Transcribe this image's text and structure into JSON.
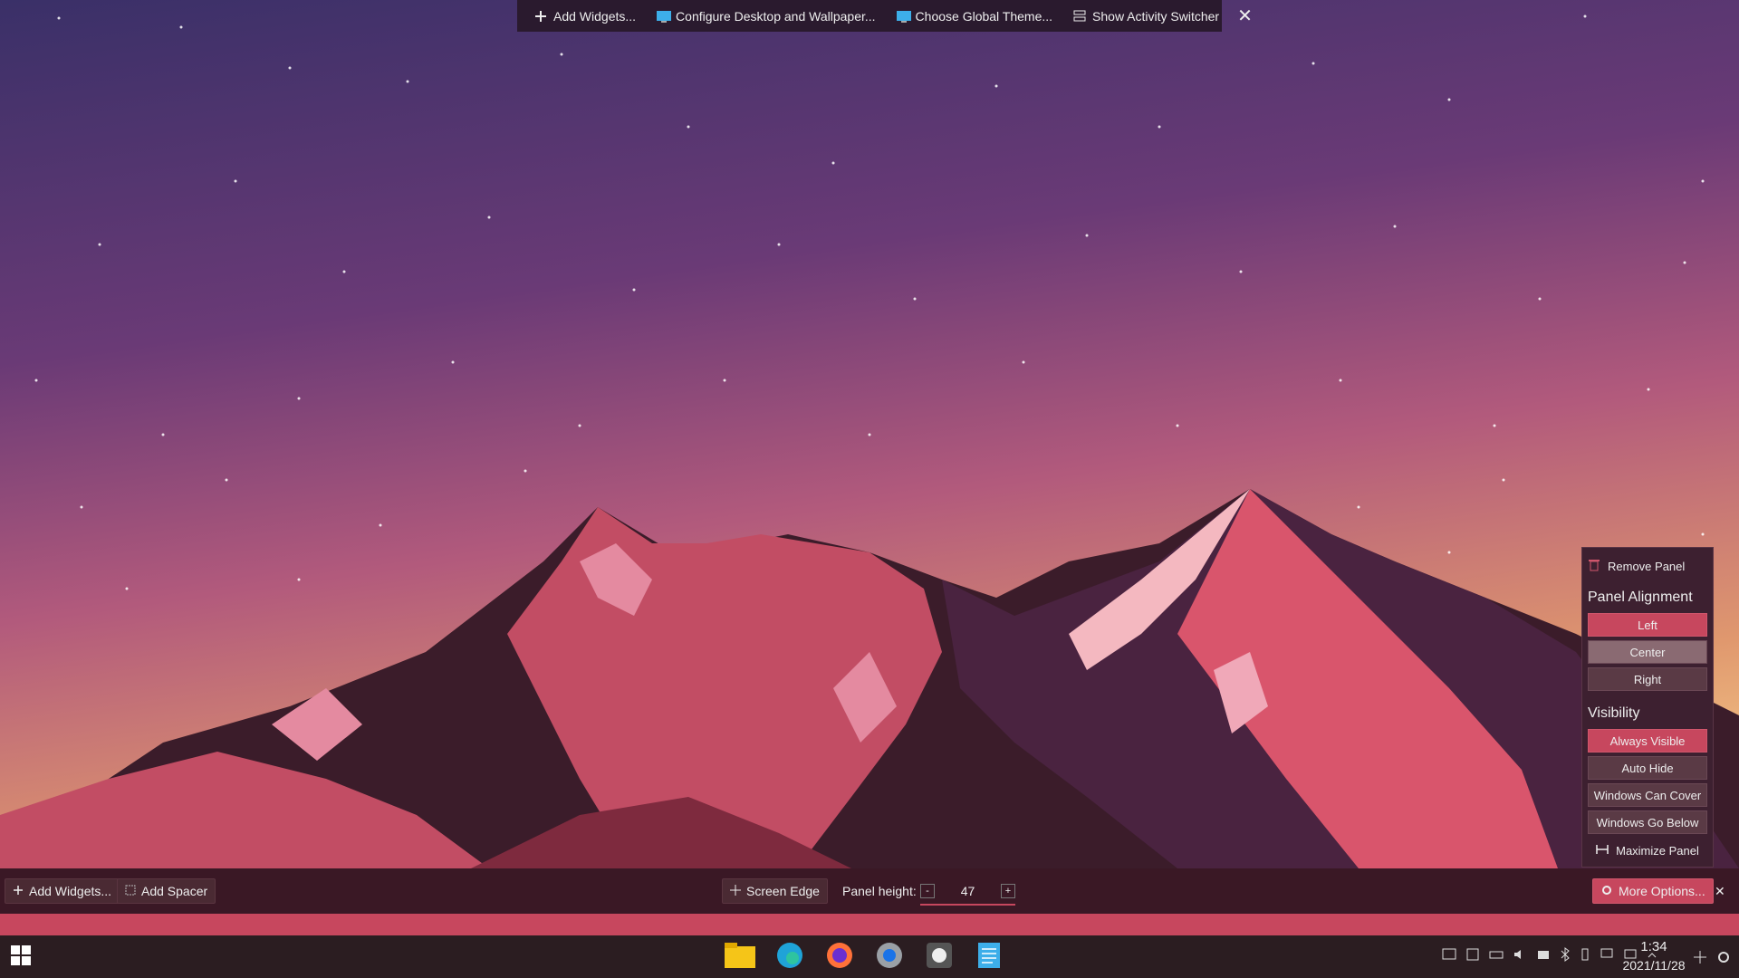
{
  "toolbox": {
    "add_widgets": "Add Widgets...",
    "configure_desktop": "Configure Desktop and Wallpaper...",
    "choose_theme": "Choose Global Theme...",
    "activity_switcher": "Show Activity Switcher",
    "close": "✕"
  },
  "editbar": {
    "add_widgets": "Add Widgets...",
    "add_spacer": "Add Spacer",
    "screen_edge": "Screen Edge",
    "panel_height_label": "Panel height:",
    "panel_height_minus": "-",
    "panel_height_value": "47",
    "panel_height_plus": "+",
    "more_options": "More Options...",
    "close": "✕"
  },
  "options_popup": {
    "remove_panel": "Remove Panel",
    "alignment_heading": "Panel Alignment",
    "alignment": [
      "Left",
      "Center",
      "Right"
    ],
    "visibility_heading": "Visibility",
    "visibility": [
      "Always Visible",
      "Auto Hide",
      "Windows Can Cover",
      "Windows Go Below"
    ],
    "maximize_panel": "Maximize Panel"
  },
  "taskbar": {
    "apps": [
      "start-icon",
      "file-manager-icon",
      "edge-dev-icon",
      "firefox-icon",
      "chromium-icon",
      "github-icon",
      "notepad-icon"
    ],
    "clock_time": "1:34",
    "clock_date": "2021/11/28"
  },
  "colors": {
    "accent": "#c7475e",
    "panel": "#2b1d21"
  }
}
